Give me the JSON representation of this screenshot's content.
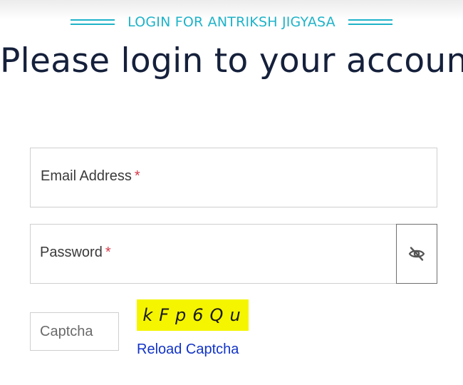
{
  "header": {
    "eyebrow": "LOGIN FOR ANTRIKSH JIGYASA",
    "title": "Please login to your account",
    "accent_color": "#1fb3c9",
    "title_color": "#15203b"
  },
  "form": {
    "email": {
      "label": "Email Address",
      "required_mark": "*"
    },
    "password": {
      "label": "Password",
      "required_mark": "*",
      "toggle_icon": "eye-slash-icon"
    },
    "captcha": {
      "placeholder": "Captcha",
      "image_text": "kFp6Qu",
      "image_bg": "#f5f500",
      "reload_label": "Reload Captcha",
      "link_color": "#1133c8"
    }
  }
}
